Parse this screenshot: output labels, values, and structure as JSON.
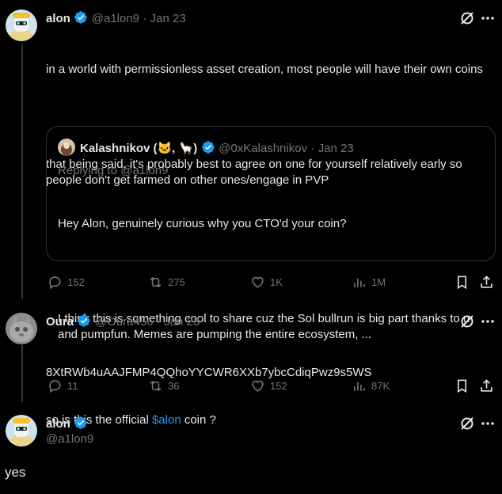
{
  "tweet1": {
    "name": "alon",
    "handle": "@a1lon9",
    "date": "· Jan 23",
    "text_line1": "in a world with permissionless asset creation, most people will have their own coins",
    "text_line2": "that being said, it's probably best to agree on one for yourself relatively early so people don't get farmed on other ones/engage in PVP",
    "quote": {
      "name": "Kalashnikov (🐱, 🦙)",
      "handle": "@0xKalashnikov",
      "date": "· Jan 23",
      "replying": "Replying to @a1lon9",
      "text_line1": "Hey Alon, genuinely curious why you CTO'd your coin?",
      "text_line2": "I think this is something cool to share cuz the Sol bullrun is big part thanks to u and pumpfun. Memes are pumping the entire ecosystem, ..."
    },
    "stats": {
      "replies": "152",
      "reposts": "275",
      "likes": "1K",
      "views": "1M"
    }
  },
  "tweet2": {
    "name": "Oura",
    "handle": "@Oura456",
    "date": "· Jan 23",
    "text_line1": "8XtRWb4uAAJFMP4QQhoYYCWR6XXb7ybcCdiqPwz9s5WS",
    "text_pre": "so is this the official ",
    "text_link": "$alon",
    "text_post": " coin ?",
    "stats": {
      "replies": "11",
      "reposts": "36",
      "likes": "152",
      "views": "87K"
    }
  },
  "tweet3": {
    "name": "alon",
    "handle": "@a1lon9",
    "text": "yes"
  },
  "colors": {
    "accent": "#1d9bf0",
    "muted": "#71767b",
    "text": "#e7e9ea",
    "border": "#2f3336"
  }
}
